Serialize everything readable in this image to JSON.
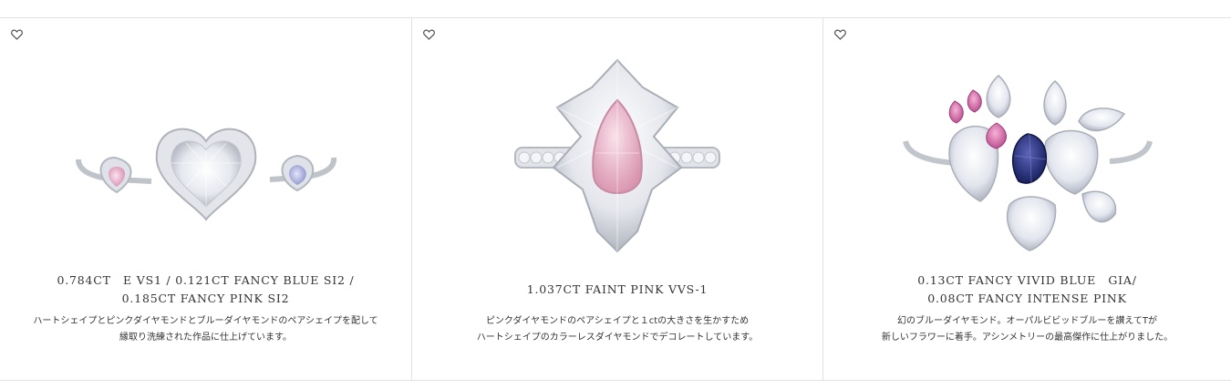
{
  "products": [
    {
      "title_lines": [
        "0.784CT　E VS1 / 0.121CT FANCY BLUE SI2 /",
        "0.185CT FANCY PINK SI2"
      ],
      "desc_lines": [
        "ハートシェイプとピンクダイヤモンドとブルーダイヤモンドのペアシェイプを配して",
        "縁取り洗練された作品に仕上げています。"
      ],
      "favorite_icon": "heart-outline-icon"
    },
    {
      "title_lines": [
        "1.037CT FAINT PINK VVS-1"
      ],
      "desc_lines": [
        "ピンクダイヤモンドのペアシェイプと１ctの大きさを生かすため",
        "ハートシェイプのカラーレスダイヤモンドでデコレートしています。"
      ],
      "favorite_icon": "heart-outline-icon"
    },
    {
      "title_lines": [
        "0.13CT FANCY VIVID BLUE　GIA/",
        "0.08CT FANCY INTENSE PINK"
      ],
      "desc_lines": [
        "幻のブルーダイヤモンド。オーパルビビッドブルーを讃えてTが",
        "新しいフラワーに着手。アシンメトリーの最高傑作に仕上がりました。"
      ],
      "favorite_icon": "heart-outline-icon"
    }
  ],
  "colors": {
    "border": "#e2e2e2",
    "text": "#333333",
    "pink_diamond": "#e7a9c6",
    "blue_diamond": "#1e2a6e",
    "white_diamond": "#eef0f6",
    "platinum": "#c9ccd2"
  }
}
